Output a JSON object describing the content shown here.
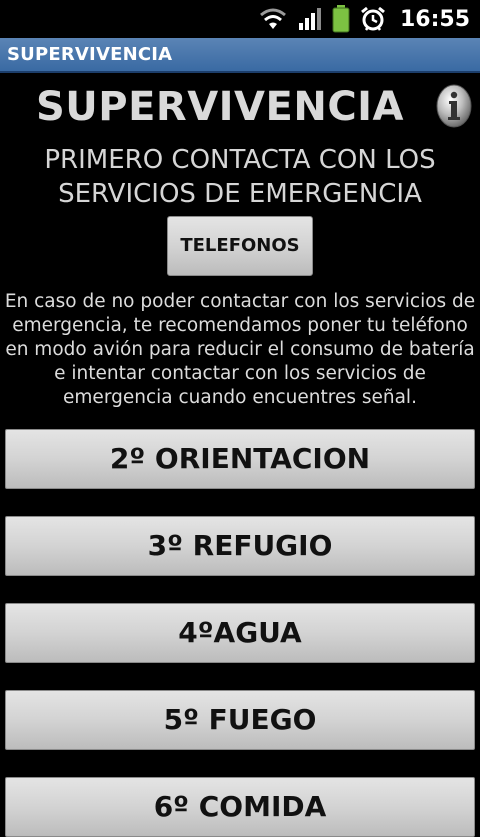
{
  "status_bar": {
    "time": "16:55",
    "icons": [
      "wifi-icon",
      "signal-icon",
      "battery-icon",
      "alarm-icon"
    ]
  },
  "app_bar": {
    "title": "SUPERVIVENCIA"
  },
  "header": {
    "title": "SUPERVIVENCIA",
    "info_icon": "info-icon"
  },
  "main": {
    "subtitle_line1": "PRIMERO CONTACTA CON LOS",
    "subtitle_line2": "SERVICIOS DE EMERGENCIA",
    "phones_button_label": "TELEFONOS",
    "advice_lines": [
      "En caso de no poder contactar con los servicios de",
      "emergencia, te recomendamos poner tu teléfono",
      "en modo avión para reducir el consumo de batería",
      "e intentar contactar con los servicios de",
      "emergencia cuando encuentres señal."
    ],
    "menu_buttons": [
      {
        "label": "2º ORIENTACION"
      },
      {
        "label": "3º REFUGIO"
      },
      {
        "label": "4ºAGUA"
      },
      {
        "label": "5º FUEGO"
      },
      {
        "label": "6º COMIDA"
      }
    ]
  },
  "colors": {
    "background": "#000000",
    "title_bar": "#4b77ad",
    "button": "#d3d3d3",
    "battery": "#7cc242"
  }
}
